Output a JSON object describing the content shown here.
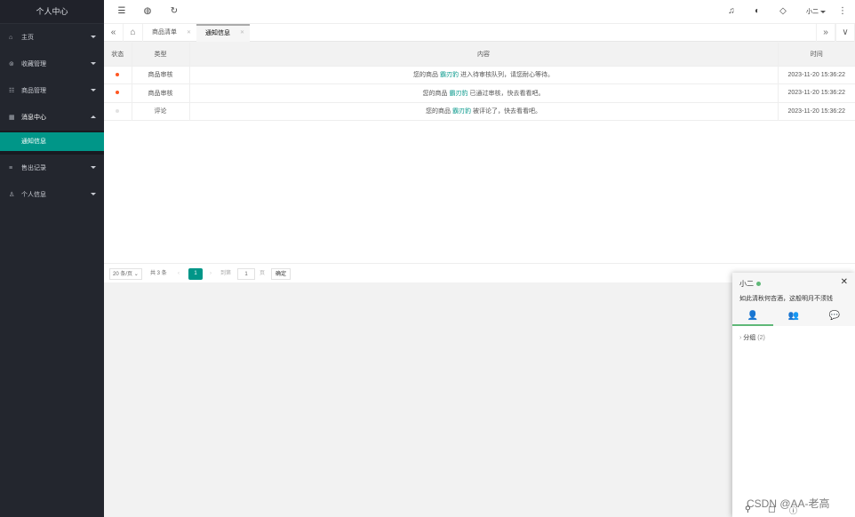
{
  "sidebar": {
    "title": "个人中心",
    "items": [
      {
        "icon": "home-icon",
        "glyph": "⌂",
        "label": "主页"
      },
      {
        "icon": "collection-icon",
        "glyph": "⊚",
        "label": "收藏管理"
      },
      {
        "icon": "goods-icon",
        "glyph": "☷",
        "label": "商品管理"
      },
      {
        "icon": "message-icon",
        "glyph": "▦",
        "label": "消息中心"
      },
      {
        "icon": "sales-icon",
        "glyph": "≡",
        "label": "售出记录"
      },
      {
        "icon": "user-icon",
        "glyph": "♙",
        "label": "个人信息"
      }
    ],
    "sub_item": "通知信息"
  },
  "header": {
    "user": "小二"
  },
  "tabs": [
    {
      "label": "商品清单"
    },
    {
      "label": "通知信息"
    }
  ],
  "table": {
    "columns": [
      "状态",
      "类型",
      "内容",
      "时间"
    ],
    "rows": [
      {
        "status_color": "#ff5722",
        "type": "商品审核",
        "pre": "您的商品",
        "item": "霸刃豹",
        "post": "进入待审核队列，请您耐心等待。",
        "time": "2023-11-20 15:36:22"
      },
      {
        "status_color": "#ff5722",
        "type": "商品审核",
        "pre": "您的商品",
        "item": "霸刃豹",
        "post": "已通过审核，快去看看吧。",
        "time": "2023-11-20 15:36:22"
      },
      {
        "status_color": "#e2e2e2",
        "type": "评论",
        "pre": "您的商品",
        "item": "霸刃豹",
        "post": "被评论了，快去看看吧。",
        "time": "2023-11-20 15:36:22"
      }
    ]
  },
  "pager": {
    "per_page": "20 条/页",
    "total": "共 3 条",
    "current": "1",
    "goto_label": "到第",
    "goto_value": "1",
    "page_unit": "页",
    "confirm": "确定"
  },
  "chat": {
    "name": "小二",
    "sign": "如此清秋何吝酒，这般明月不须钱",
    "group_label": "分组",
    "group_count": "(2)"
  },
  "watermark": "CSDN @AA-老高",
  "colors": {
    "accent": "#009688",
    "sidebar_bg": "#23262e",
    "online": "#5fb878",
    "unread": "#ff5722"
  }
}
